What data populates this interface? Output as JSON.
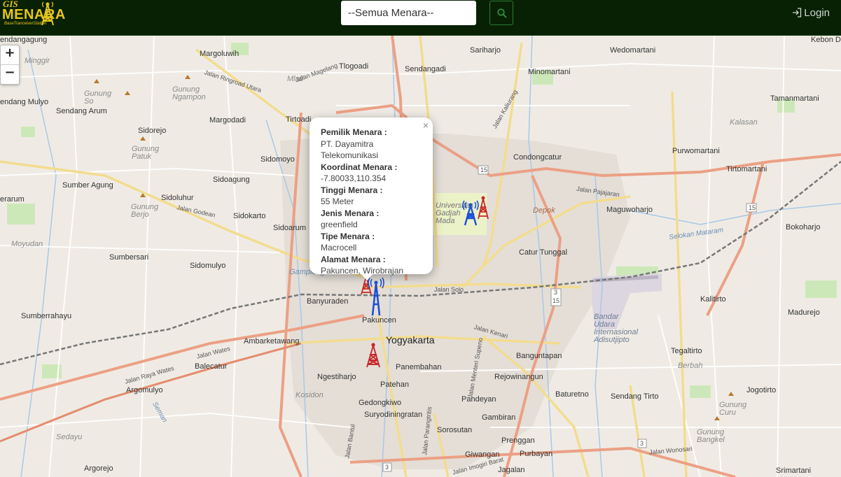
{
  "header": {
    "logo_line1": "GIS",
    "logo_line2": "MENARA",
    "logo_line3": "BaseTranceiverStation",
    "search_select_value": "--Semua Menara--",
    "search_icon": "search-icon",
    "login_label": "Login",
    "login_icon": "login-icon"
  },
  "zoom": {
    "in_label": "+",
    "out_label": "−"
  },
  "popup": {
    "close_label": "×",
    "fields": [
      {
        "key": "Pemilik Menara :",
        "value": "PT. Dayamitra Telekomunikasi"
      },
      {
        "key": "Koordinat Menara :",
        "value": "-7.80033,110.354"
      },
      {
        "key": "Tinggi Menara :",
        "value": "55 Meter"
      },
      {
        "key": "Jenis Menara :",
        "value": "greenfield"
      },
      {
        "key": "Tipe Menara :",
        "value": "Macrocell"
      },
      {
        "key": "Alamat Menara :",
        "value": "Pakuncen, Wirobrajan"
      }
    ]
  },
  "map_labels": {
    "l01": "endangagung",
    "l02": "Margoluwih",
    "l03": "Sariharjo",
    "l04": "Wedomartani",
    "l05": "Kebon Dalem",
    "l06": "Minggir",
    "l07": "Tlogoadi",
    "l08": "Sendangadi",
    "l09": "Minomartani",
    "l10": "Gunung So",
    "l11": "Gunung Ngampon",
    "l12": "endang Mulyo",
    "l13": "Sendang Arum",
    "l14": "Margodadi",
    "l15": "Tirtoadi",
    "l16": "Tamanmartani",
    "l17": "Kalasan",
    "l18": "Sidorejo",
    "l19": "Gunung Patuk",
    "l20": "Sidomoyo",
    "l21": "Condongcatur",
    "l22": "Purwomartani",
    "l23": "Sumber Agung",
    "l24": "Sidoagung",
    "l25": "Tirtomartani",
    "l26": "erarum",
    "l27": "Sidoluhur",
    "l28": "Gunung Berjo",
    "l29": "Sidokarto",
    "l30": "Maguwoharjo",
    "l31": "Sidoarum",
    "l32": "Bokoharjo",
    "l33": "Moyudan",
    "l34": "Catur Tunggal",
    "l35": "Sumbersari",
    "l36": "Sidomulyo",
    "l37": "Banyuraden",
    "l38": "Pakuncen",
    "l39": "Kalitirto",
    "l40": "Madurejo",
    "l41": "Sumberrahayu",
    "l42": "Ambarketawang",
    "l43": "Yogyakarta",
    "l44": "Bandar Udara Internasional Adisutjipto",
    "l45": "Balecatur",
    "l46": "Panembahan",
    "l47": "Banguntapan",
    "l48": "Tegaltirto",
    "l49": "Berbah",
    "l50": "Gamplongan",
    "l51": "Ngestiharjo",
    "l52": "Rejowinangun",
    "l53": "Patehan",
    "l54": "Baturetno",
    "l55": "Sendang Tirto",
    "l56": "Jogotirto",
    "l57": "Argomulyo",
    "l58": "Pandeyan",
    "l59": "Gedongkiwo",
    "l60": "Suryodiningratan",
    "l61": "Gambiran",
    "l62": "Gunung Curu",
    "l63": "Sorosutan",
    "l64": "Gunung Bangkel",
    "l65": "Sedayu",
    "l66": "Prenggan",
    "l67": "Giwangan",
    "l68": "Purbayan",
    "l69": "Argorejo",
    "l70": "Jagalan",
    "l71": "Srimartani",
    "l72": "Depok",
    "l73": "Universitas Gadjah Mada",
    "l74": "Selokan Mataram",
    "l75": "Mlati",
    "l76": "Jalan Godean",
    "l77": "Jalan Wates",
    "l78": "Jalan Raya Wates",
    "l79": "Jalan Solo",
    "l80": "Jalan Kaliurang",
    "l81": "Jalan Magelang",
    "l82": "Jalan Ringroad Utara",
    "l83": "Jalan Wonosari",
    "l84": "Jalan Parangtritis",
    "l85": "Jalan Bantul",
    "l86": "Kosidon",
    "l87": "Seman",
    "l88": "Jalan Kenari",
    "l89": "Jalan Menteri Supeno",
    "l90": "Jalan Imogiri Barat",
    "s1": "15",
    "s2": "15",
    "s3": "3",
    "s4": "15",
    "s5": "3",
    "s6": "3",
    "l91": "Jalan Pajajaran"
  },
  "colors": {
    "navbar": "#082105",
    "logo_gold": "#e6c51c",
    "tower_blue": "#1d4fd8",
    "tower_red": "#c62828",
    "primary_road": "#f0a07d",
    "secondary_road": "#f6e5a0",
    "railway": "#777777"
  }
}
